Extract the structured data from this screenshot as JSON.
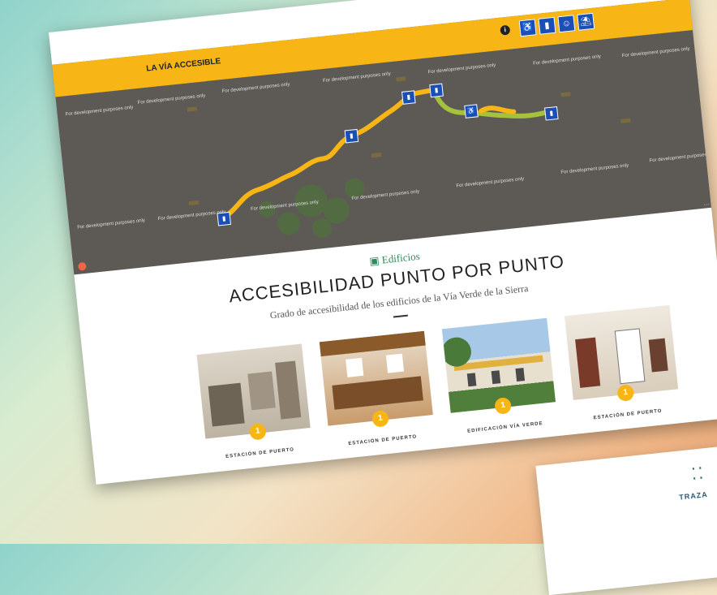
{
  "header": {
    "title": "LA VÍA ACCESIBLE",
    "info_icon": "info-icon",
    "icons": [
      "wheelchair-icon",
      "building-icon",
      "people-icon",
      "picnic-icon"
    ]
  },
  "map": {
    "watermark": "For development purposes only",
    "route_colors": [
      "#f7b516",
      "#9fb83a"
    ],
    "pin_icon": "building-icon",
    "wheelchair_pin_icon": "wheelchair-icon"
  },
  "section": {
    "label": "Edificios",
    "label_icon": "building-icon",
    "title": "ACCESIBILIDAD PUNTO POR PUNTO",
    "subtitle": "Grado de accesibilidad de los edificios de la Vía Verde de la Sierra"
  },
  "cards": [
    {
      "caption": "ESTACIÓN DE PUERTO",
      "badge": "1"
    },
    {
      "caption": "ESTACIÓN DE PUERTO",
      "badge": "1"
    },
    {
      "caption": "EDIFICACIÓN VÍA VERDE",
      "badge": "1"
    },
    {
      "caption": "ESTACIÓN DE PUERTO",
      "badge": "1"
    }
  ],
  "background": {
    "logo_text": "TRAZA"
  }
}
